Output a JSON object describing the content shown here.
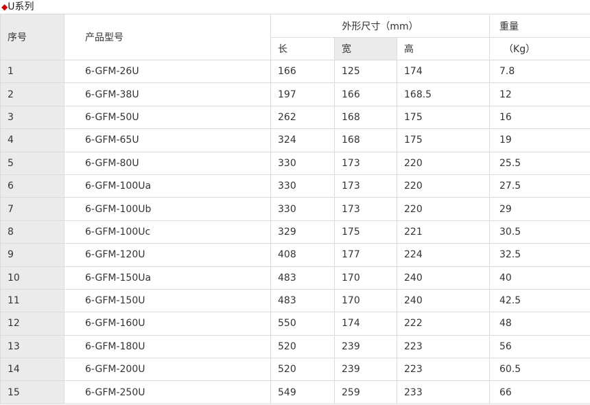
{
  "title": {
    "marker": "◆",
    "text": "U系列"
  },
  "headers": {
    "seq": "序号",
    "model": "产品型号",
    "dimensions": "外形尺寸（mm）",
    "length": "长",
    "width": "宽",
    "height": "高",
    "weight": "重量",
    "weight_unit": "（Kg）"
  },
  "rows": [
    {
      "seq": "1",
      "model": "6-GFM-26U",
      "length": "166",
      "width": "125",
      "height": "174",
      "weight": "7.8"
    },
    {
      "seq": "2",
      "model": "6-GFM-38U",
      "length": "197",
      "width": "166",
      "height": "168.5",
      "weight": "12"
    },
    {
      "seq": "3",
      "model": "6-GFM-50U",
      "length": "262",
      "width": "168",
      "height": "175",
      "weight": "16"
    },
    {
      "seq": "4",
      "model": "6-GFM-65U",
      "length": "324",
      "width": "168",
      "height": "175",
      "weight": "19"
    },
    {
      "seq": "5",
      "model": "6-GFM-80U",
      "length": "330",
      "width": "173",
      "height": "220",
      "weight": "25.5"
    },
    {
      "seq": "6",
      "model": "6-GFM-100Ua",
      "length": "330",
      "width": "173",
      "height": "220",
      "weight": "27.5"
    },
    {
      "seq": "7",
      "model": "6-GFM-100Ub",
      "length": "330",
      "width": "173",
      "height": "220",
      "weight": "29"
    },
    {
      "seq": "8",
      "model": "6-GFM-100Uc",
      "length": "329",
      "width": "175",
      "height": "221",
      "weight": "30.5"
    },
    {
      "seq": "9",
      "model": "6-GFM-120U",
      "length": "408",
      "width": "177",
      "height": "224",
      "weight": "32.5"
    },
    {
      "seq": "10",
      "model": "6-GFM-150Ua",
      "length": "483",
      "width": "170",
      "height": "240",
      "weight": "40"
    },
    {
      "seq": "11",
      "model": "6-GFM-150U",
      "length": "483",
      "width": "170",
      "height": "240",
      "weight": "42.5"
    },
    {
      "seq": "12",
      "model": "6-GFM-160U",
      "length": "550",
      "width": "174",
      "height": "222",
      "weight": "48"
    },
    {
      "seq": "13",
      "model": "6-GFM-180U",
      "length": "520",
      "width": "239",
      "height": "223",
      "weight": "56"
    },
    {
      "seq": "14",
      "model": "6-GFM-200U",
      "length": "520",
      "width": "239",
      "height": "223",
      "weight": "60.5"
    },
    {
      "seq": "15",
      "model": "6-GFM-250U",
      "length": "549",
      "width": "259",
      "height": "233",
      "weight": "66"
    }
  ],
  "colors": {
    "marker": "#cc0000",
    "shade": "#ebebeb",
    "border": "#dcdcdc",
    "text": "#333333"
  }
}
